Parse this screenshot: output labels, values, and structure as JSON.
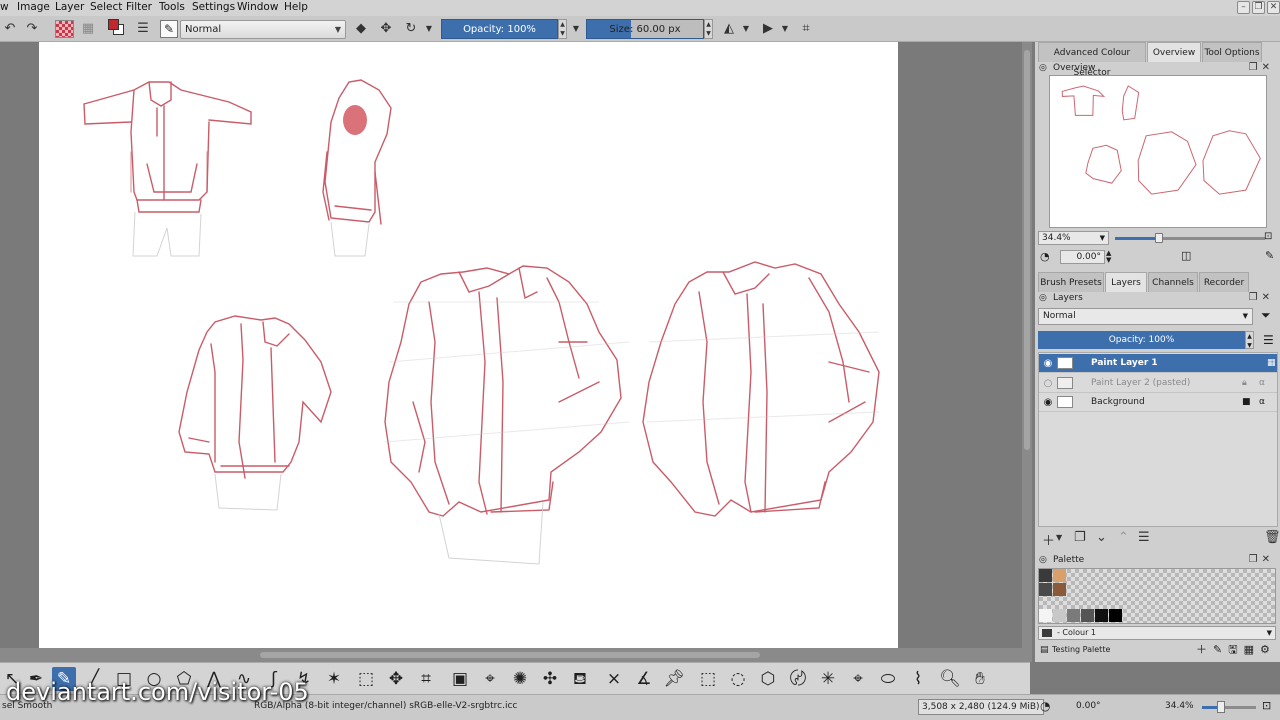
{
  "menu": {
    "items": [
      "w",
      "Image",
      "Layer",
      "Select",
      "Filter",
      "Tools",
      "Settings",
      "Window",
      "Help"
    ]
  },
  "toolbar": {
    "blend_mode": "Normal",
    "opacity": "Opacity: 100%",
    "size": "Size: 60.00 px",
    "foreground_color": "#c1272d",
    "background_color": "#ffffff"
  },
  "docker": {
    "top_tabs": [
      "Advanced Colour Selector",
      "Overview",
      "Tool Options"
    ],
    "overview_title": "Overview",
    "zoom_value": "34.4%",
    "zoom_fraction": 0.29,
    "rotation_value": "0.00°",
    "mid_tabs": [
      "Brush Presets",
      "Layers",
      "Channels",
      "Recorder"
    ],
    "layers_title": "Layers",
    "layer_blend": "Normal",
    "layer_opacity": "Opacity: 100%",
    "layers": [
      {
        "name": "Paint Layer 1",
        "state": "selected"
      },
      {
        "name": "Paint Layer 2 (pasted)",
        "state": "hidden"
      },
      {
        "name": "Background",
        "state": "locked"
      }
    ],
    "palette_title": "Palette",
    "palette_colour": "- Colour 1",
    "palette_name": "Testing Palette",
    "palette_swatches": [
      "#3a3a3a",
      "#d9a06b",
      "#4a4a4a",
      "#8a5a3a",
      "#f4f4f4",
      "#c8c8c8",
      "#7a7a7a",
      "#555555",
      "#111111",
      "#000000"
    ]
  },
  "status": {
    "brush": "sel Smooth",
    "color_space": "RGB/Alpha (8-bit integer/channel)  sRGB-elle-V2-srgbtrc.icc",
    "image_size": "3,508 x 2,480 (124.9 MiB)",
    "rotation": "0.00°",
    "zoom": "34.4%",
    "zoom_fraction": 0.35
  },
  "watermark": "deviantart.com/visitor-05",
  "colors": {
    "accent": "#3d6fad",
    "sketch_red": "#c0404e"
  }
}
